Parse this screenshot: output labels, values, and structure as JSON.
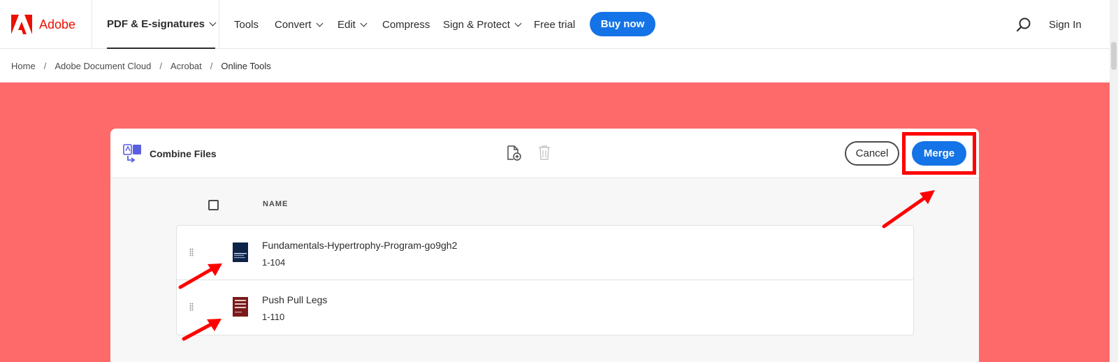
{
  "brand": {
    "name": "Adobe",
    "color": "#eb1000"
  },
  "nav": {
    "primary": "PDF & E-signatures",
    "items": [
      "Tools",
      "Convert",
      "Edit",
      "Compress",
      "Sign & Protect",
      "Free trial"
    ],
    "buy_label": "Buy now",
    "signin_label": "Sign In",
    "accent": "#1473e6"
  },
  "breadcrumb": [
    "Home",
    "Adobe Document Cloud",
    "Acrobat",
    "Online Tools"
  ],
  "hero": {
    "background": "#fe6a6a"
  },
  "panel": {
    "title": "Combine Files",
    "cancel_label": "Cancel",
    "merge_label": "Merge",
    "column_name": "NAME",
    "files": [
      {
        "name": "Fundamentals-Hypertrophy-Program-go9gh2",
        "pages": "1-104",
        "thumb_color": "#0d2347"
      },
      {
        "name": "Push Pull Legs",
        "pages": "1-110",
        "thumb_color": "#7a1a1a"
      }
    ]
  },
  "annotation": {
    "color": "#ff0000"
  }
}
